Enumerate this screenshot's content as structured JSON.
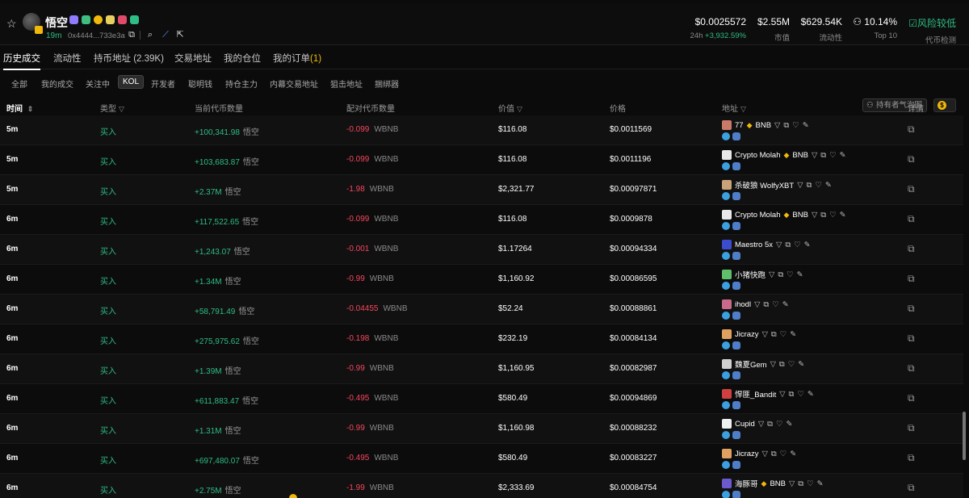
{
  "token": {
    "name": "悟空",
    "age": "19m",
    "address": "0x4444...733e3a"
  },
  "stats": [
    {
      "value": "$0.0025572",
      "label_prefix": "24h",
      "label_change": "+3,932.59%"
    },
    {
      "value": "$2.55M",
      "label": "市值"
    },
    {
      "value": "$629.54K",
      "label": "流动性"
    },
    {
      "value": "10.14%",
      "label": "Top 10"
    },
    {
      "value": "风险较低",
      "label": "代币检测"
    }
  ],
  "tabs": [
    {
      "label": "历史成交"
    },
    {
      "label": "流动性"
    },
    {
      "label": "持币地址",
      "count": "(2.39K)"
    },
    {
      "label": "交易地址"
    },
    {
      "label": "我的仓位"
    },
    {
      "label": "我的订单",
      "count": "(1)"
    }
  ],
  "bubble_button": "持有者气泡图",
  "filters": [
    "全部",
    "我的成交",
    "关注中",
    "KOL",
    "开发者",
    "聪明钱",
    "持仓主力",
    "内幕交易地址",
    "狙击地址",
    "捆绑器"
  ],
  "columns": {
    "time": "时间",
    "type": "类型",
    "amount": "当前代币数量",
    "pair": "配对代币数量",
    "value": "价值",
    "price": "价格",
    "address": "地址",
    "detail": "详情"
  },
  "rows": [
    {
      "time": "5m",
      "type": "买入",
      "amount": "+100,341.98",
      "unit": "悟空",
      "pair": "-0.099",
      "pair_unit": "WBNB",
      "value": "$116.08",
      "price": "$0.0011569",
      "name": "77",
      "bnb": "BNB",
      "pfp": "#c97b6a"
    },
    {
      "time": "5m",
      "type": "买入",
      "amount": "+103,683.87",
      "unit": "悟空",
      "pair": "-0.099",
      "pair_unit": "WBNB",
      "value": "$116.08",
      "price": "$0.0011196",
      "name": "Crypto Molah",
      "bnb": "BNB",
      "pfp": "#e8e8e8"
    },
    {
      "time": "5m",
      "type": "买入",
      "amount": "+2.37M",
      "unit": "悟空",
      "pair": "-1.98",
      "pair_unit": "WBNB",
      "value": "$2,321.77",
      "price": "$0.00097871",
      "name": "杀破狼 WolfyXBT",
      "bnb": "",
      "pfp": "#c9a27a"
    },
    {
      "time": "6m",
      "type": "买入",
      "amount": "+117,522.65",
      "unit": "悟空",
      "pair": "-0.099",
      "pair_unit": "WBNB",
      "value": "$116.08",
      "price": "$0.0009878",
      "name": "Crypto Molah",
      "bnb": "BNB",
      "pfp": "#e8e8e8"
    },
    {
      "time": "6m",
      "type": "买入",
      "amount": "+1,243.07",
      "unit": "悟空",
      "pair": "-0.001",
      "pair_unit": "WBNB",
      "value": "$1.17264",
      "price": "$0.00094334",
      "name": "Maestro 5x",
      "bnb": "",
      "pfp": "#3b4ccf"
    },
    {
      "time": "6m",
      "type": "买入",
      "amount": "+1.34M",
      "unit": "悟空",
      "pair": "-0.99",
      "pair_unit": "WBNB",
      "value": "$1,160.92",
      "price": "$0.00086595",
      "name": "小猪快跑",
      "bnb": "",
      "pfp": "#5fbf6a"
    },
    {
      "time": "6m",
      "type": "买入",
      "amount": "+58,791.49",
      "unit": "悟空",
      "pair": "-0.04455",
      "pair_unit": "WBNB",
      "value": "$52.24",
      "price": "$0.00088861",
      "name": "ihodl",
      "bnb": "",
      "pfp": "#c96a8a"
    },
    {
      "time": "6m",
      "type": "买入",
      "amount": "+275,975.62",
      "unit": "悟空",
      "pair": "-0.198",
      "pair_unit": "WBNB",
      "value": "$232.19",
      "price": "$0.00084134",
      "name": "Jicrazy",
      "bnb": "",
      "pfp": "#e0a060"
    },
    {
      "time": "6m",
      "type": "买入",
      "amount": "+1.39M",
      "unit": "悟空",
      "pair": "-0.99",
      "pair_unit": "WBNB",
      "value": "$1,160.95",
      "price": "$0.00082987",
      "name": "魏夏Gem",
      "bnb": "",
      "pfp": "#d0d0d0"
    },
    {
      "time": "6m",
      "type": "买入",
      "amount": "+611,883.47",
      "unit": "悟空",
      "pair": "-0.495",
      "pair_unit": "WBNB",
      "value": "$580.49",
      "price": "$0.00094869",
      "name": "悍匪_Bandit",
      "bnb": "",
      "pfp": "#d04040"
    },
    {
      "time": "6m",
      "type": "买入",
      "amount": "+1.31M",
      "unit": "悟空",
      "pair": "-0.99",
      "pair_unit": "WBNB",
      "value": "$1,160.98",
      "price": "$0.00088232",
      "name": "Cupid",
      "bnb": "",
      "pfp": "#f0f0f0"
    },
    {
      "time": "6m",
      "type": "买入",
      "amount": "+697,480.07",
      "unit": "悟空",
      "pair": "-0.495",
      "pair_unit": "WBNB",
      "value": "$580.49",
      "price": "$0.00083227",
      "name": "Jicrazy",
      "bnb": "",
      "pfp": "#e0a060"
    },
    {
      "time": "6m",
      "type": "买入",
      "amount": "+2.75M",
      "unit": "悟空",
      "pair": "-1.99",
      "pair_unit": "WBNB",
      "value": "$2,333.69",
      "price": "$0.00084754",
      "name": "海豚哥",
      "bnb": "BNB",
      "pfp": "#6a5acd"
    }
  ]
}
